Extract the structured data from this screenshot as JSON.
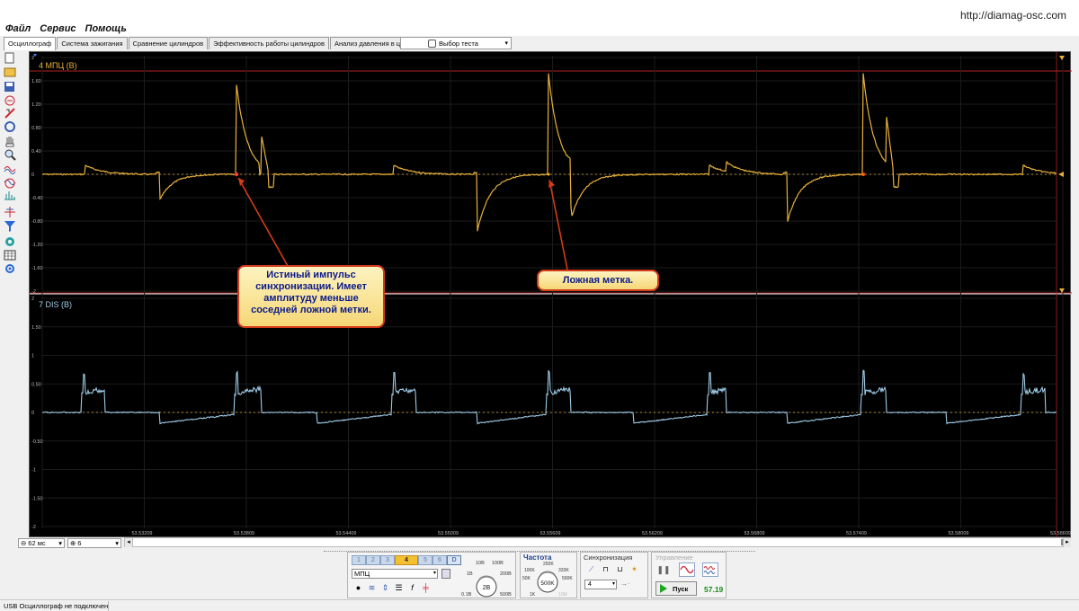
{
  "app": {
    "url": "http://diamag-osc.com"
  },
  "menu": [
    "Файл",
    "Сервис",
    "Помощь"
  ],
  "tabs": [
    "Осциллограф",
    "Система зажигания",
    "Сравнение цилиндров",
    "Эффективность работы цилиндров",
    "Анализ давления в цилиндре"
  ],
  "test_select": {
    "label": "Выбор теста"
  },
  "toolbar_left": [
    "new-file-icon",
    "open-folder-icon",
    "save-icon",
    "print-icon",
    "measure-icon",
    "probe-icon",
    "hand-icon",
    "zoom-icon",
    "waves-icon",
    "waves-alt-icon",
    "spectrum-icon",
    "cursor-icon",
    "filter-icon",
    "target-icon",
    "table-icon",
    "gear-icon"
  ],
  "channels": [
    {
      "label": "4 МПЦ (В)",
      "color": "#e8b13a",
      "y_ticks": [
        "2",
        "1.60",
        "1.20",
        "0.80",
        "0.40",
        "0",
        "-0.40",
        "-0.80",
        "-1.20",
        "-1.60",
        "-2"
      ]
    },
    {
      "label": "7 DIS (В)",
      "color": "#9ecbe6",
      "y_ticks": [
        "2",
        "1.50",
        "1",
        "0.50",
        "0",
        "-0.50",
        "-1",
        "-1.50",
        "-2"
      ]
    }
  ],
  "x_ticks": [
    "53.53209",
    "53.53809",
    "53.54409",
    "53.55009",
    "53.55609",
    "53.56209",
    "53.56809",
    "53.57409",
    "53.58009",
    "53.58609"
  ],
  "callouts": {
    "true_pulse": "Истиный импульс синхронизации. Имеет амплитуду меньше соседней ложной метки.",
    "false_mark": "Ложная метка."
  },
  "timebase": {
    "value": "62 мс",
    "zoom": "6"
  },
  "channel_panel": {
    "buttons": [
      "1",
      "2",
      "3",
      "4",
      "5",
      "6",
      "D"
    ],
    "active": "4",
    "name": "МПЦ",
    "knob_labels": [
      "10В",
      "100В",
      "1В",
      "200В",
      "0.1В",
      "500В"
    ],
    "knob_value": "2В"
  },
  "freq_panel": {
    "title": "Частота",
    "labels": [
      "250K",
      "100K",
      "333K",
      "50K",
      "500K",
      "1K",
      "10M"
    ],
    "value": "500K"
  },
  "sync_panel": {
    "title": "Синхронизация",
    "channel": "4"
  },
  "control_panel": {
    "title": "Управление",
    "run_label": "Пуск",
    "fps": "57.19"
  },
  "status": {
    "text": "USB Осциллограф не подключен"
  }
}
